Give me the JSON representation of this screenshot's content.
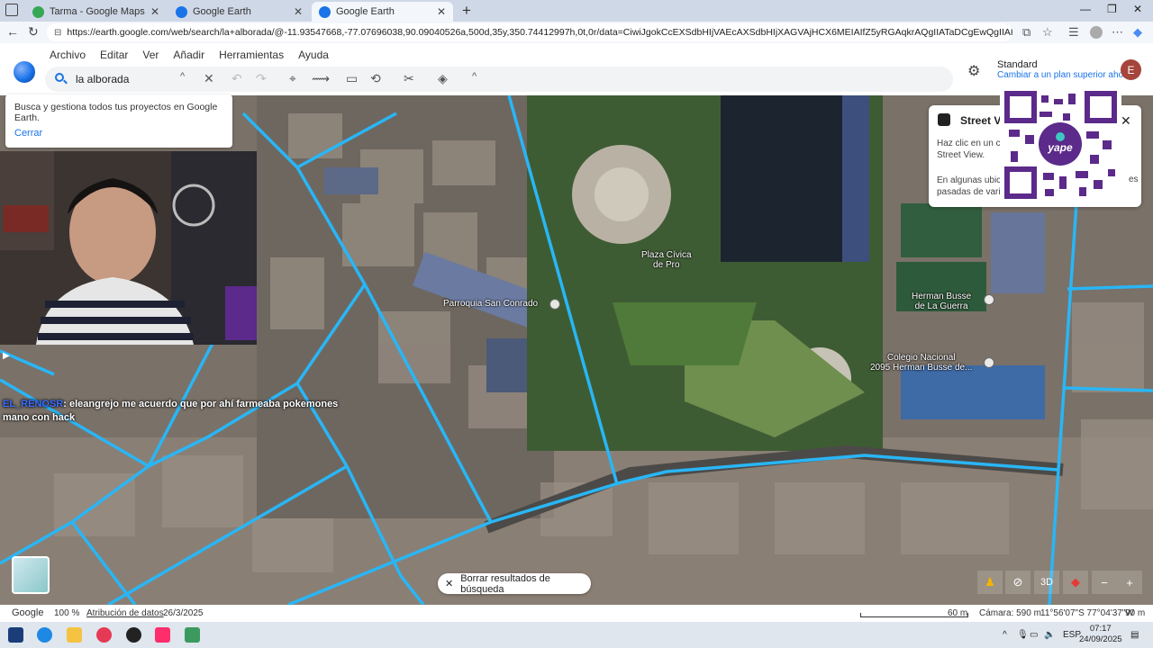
{
  "browser": {
    "tabs": [
      {
        "title": "Tarma - Google Maps",
        "active": false,
        "favicon_color": "#34a853"
      },
      {
        "title": "Google Earth",
        "active": false,
        "favicon_color": "#1a73e8"
      },
      {
        "title": "Google Earth",
        "active": true,
        "favicon_color": "#1a73e8"
      }
    ],
    "url": "https://earth.google.com/web/search/la+alborada/@-11.93547668,-77.07696038,90.09040526a,500d,35y,350.74412997h,0t,0r/data=CiwiJgokCcEXSdbHIjVAEcAXSdbHIjXAGVAjHCX6MEIAIfZ5yRGAqkrAQgIIATaDCgEwQgIIAEoNCP________wEQAA"
  },
  "menu": [
    "Archivo",
    "Editar",
    "Ver",
    "Añadir",
    "Herramientas",
    "Ayuda"
  ],
  "search": {
    "value": "la alborada"
  },
  "account": {
    "plan": "Standard",
    "upgrade_link": "Cambiar a un plan superior ahora",
    "avatar_letter": "E"
  },
  "info_popup": {
    "text": "Busca y gestiona todos tus proyectos en Google Earth.",
    "close_label": "Cerrar"
  },
  "map_labels": {
    "plaza": "Plaza Cívica\nde Pro",
    "parroquia": "Parroquia San Conrado",
    "herman": "Herman Busse\nde La Guerra",
    "colegio": "Colegio Nacional\n2095 Herman Busse de..."
  },
  "chat": {
    "user": "EL_RENOSR",
    "message": "eleangrejo me acuerdo que por ahí farmeaba pokemones mano con hack"
  },
  "street_view": {
    "title": "Street Vi",
    "text1": "Haz clic en un c Street View.",
    "text2": "En algunas ubica pasadas de varia",
    "text3": "es"
  },
  "clear_results_label": "Borrar resultados de búsqueda",
  "map_controls": {
    "mode_3d": "3D"
  },
  "status": {
    "brand": "Google",
    "zoom": "100 %",
    "attribution": "Atribución de datos",
    "date": "26/3/2025",
    "scale": "60 m",
    "camera": "Cámara: 590 m",
    "coords": "11°56'07\"S 77°04'37\"W",
    "elevation": "90 m"
  },
  "taskbar": {
    "lang": "ESP",
    "time": "07:17",
    "date": "24/09/2025"
  }
}
